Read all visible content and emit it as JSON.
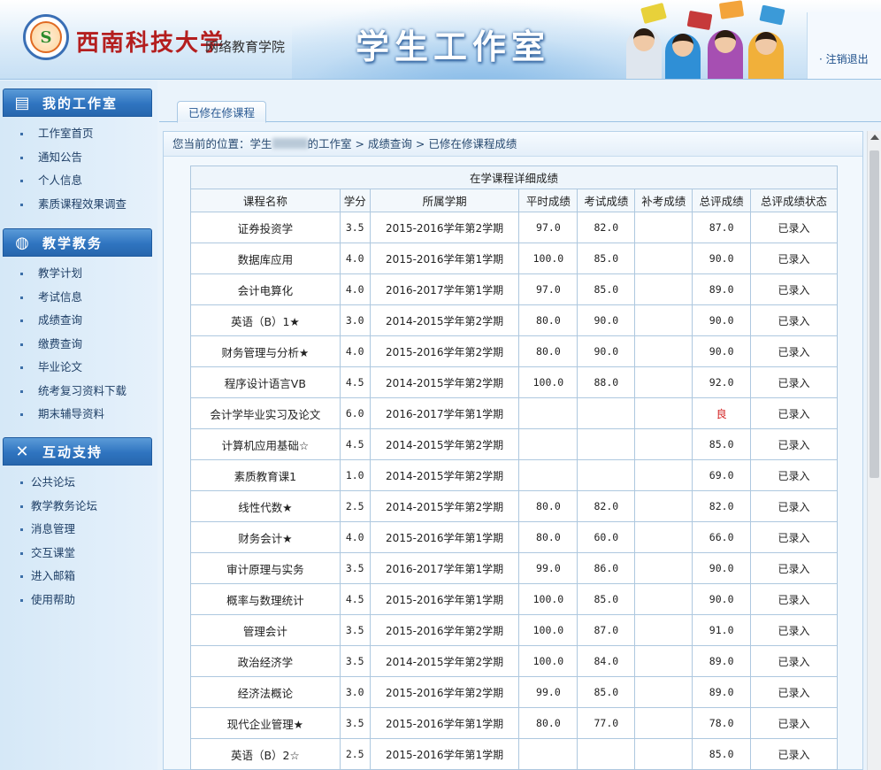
{
  "header": {
    "university": "西南科技大学",
    "college": "网络教育学院",
    "title": "学生工作室",
    "logout": "· 注销退出"
  },
  "sidebar": {
    "sections": [
      {
        "title": "我的工作室",
        "icon": "folder-icon",
        "items": [
          "工作室首页",
          "通知公告",
          "个人信息",
          "素质课程效果调查"
        ]
      },
      {
        "title": "教学教务",
        "icon": "globe-icon",
        "items": [
          "教学计划",
          "考试信息",
          "成绩查询",
          "缴费查询",
          "毕业论文",
          "统考复习资料下载",
          "期末辅导资料"
        ]
      },
      {
        "title": "互动支持",
        "icon": "tools-icon",
        "items": [
          "公共论坛",
          "教学教务论坛",
          "消息管理",
          "交互课堂",
          "进入邮箱",
          "使用帮助"
        ]
      }
    ]
  },
  "tab": {
    "label": "已修在修课程"
  },
  "breadcrumb": {
    "prefix": "您当前的位置：学生",
    "suffix": "的工作室 > 成绩查询 > 已修在修课程成绩"
  },
  "table": {
    "caption": "在学课程详细成绩",
    "columns": [
      "课程名称",
      "学分",
      "所属学期",
      "平时成绩",
      "考试成绩",
      "补考成绩",
      "总评成绩",
      "总评成绩状态"
    ],
    "rows": [
      [
        "证券投资学",
        "3.5",
        "2015-2016学年第2学期",
        "97.0",
        "82.0",
        "",
        "87.0",
        "已录入"
      ],
      [
        "数据库应用",
        "4.0",
        "2015-2016学年第1学期",
        "100.0",
        "85.0",
        "",
        "90.0",
        "已录入"
      ],
      [
        "会计电算化",
        "4.0",
        "2016-2017学年第1学期",
        "97.0",
        "85.0",
        "",
        "89.0",
        "已录入"
      ],
      [
        "英语（B）1★",
        "3.0",
        "2014-2015学年第2学期",
        "80.0",
        "90.0",
        "",
        "90.0",
        "已录入"
      ],
      [
        "财务管理与分析★",
        "4.0",
        "2015-2016学年第2学期",
        "80.0",
        "90.0",
        "",
        "90.0",
        "已录入"
      ],
      [
        "程序设计语言VB",
        "4.5",
        "2014-2015学年第2学期",
        "100.0",
        "88.0",
        "",
        "92.0",
        "已录入"
      ],
      [
        "会计学毕业实习及论文",
        "6.0",
        "2016-2017学年第1学期",
        "",
        "",
        "",
        "良",
        "已录入"
      ],
      [
        "计算机应用基础☆",
        "4.5",
        "2014-2015学年第2学期",
        "",
        "",
        "",
        "85.0",
        "已录入"
      ],
      [
        "素质教育课1",
        "1.0",
        "2014-2015学年第2学期",
        "",
        "",
        "",
        "69.0",
        "已录入"
      ],
      [
        "线性代数★",
        "2.5",
        "2014-2015学年第2学期",
        "80.0",
        "82.0",
        "",
        "82.0",
        "已录入"
      ],
      [
        "财务会计★",
        "4.0",
        "2015-2016学年第1学期",
        "80.0",
        "60.0",
        "",
        "66.0",
        "已录入"
      ],
      [
        "审计原理与实务",
        "3.5",
        "2016-2017学年第1学期",
        "99.0",
        "86.0",
        "",
        "90.0",
        "已录入"
      ],
      [
        "概率与数理统计",
        "4.5",
        "2015-2016学年第1学期",
        "100.0",
        "85.0",
        "",
        "90.0",
        "已录入"
      ],
      [
        "管理会计",
        "3.5",
        "2015-2016学年第2学期",
        "100.0",
        "87.0",
        "",
        "91.0",
        "已录入"
      ],
      [
        "政治经济学",
        "3.5",
        "2014-2015学年第2学期",
        "100.0",
        "84.0",
        "",
        "89.0",
        "已录入"
      ],
      [
        "经济法概论",
        "3.0",
        "2015-2016学年第2学期",
        "99.0",
        "85.0",
        "",
        "89.0",
        "已录入"
      ],
      [
        "现代企业管理★",
        "3.5",
        "2015-2016学年第1学期",
        "80.0",
        "77.0",
        "",
        "78.0",
        "已录入"
      ],
      [
        "英语（B）2☆",
        "2.5",
        "2015-2016学年第1学期",
        "",
        "",
        "",
        "85.0",
        "已录入"
      ]
    ]
  },
  "colors": {
    "accent": "#2f74c0",
    "highlight": "#d21f1f"
  }
}
